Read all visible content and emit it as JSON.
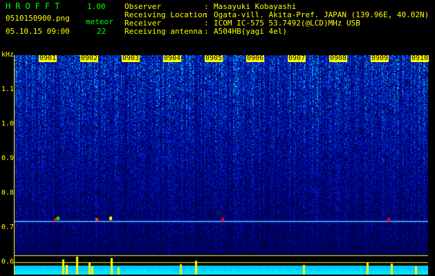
{
  "header": {
    "app_title": "HROFFT",
    "version": "1.00",
    "filename": "0510150900.png",
    "meteor_label": "meteor",
    "datetime": "05.10.15 09:00",
    "meteor_count": "22",
    "fields": [
      {
        "key": "Observer",
        "value": "Masayuki Kobayashi"
      },
      {
        "key": "Receiving Location",
        "value": "Ogata-vill. Akita-Pref. JAPAN (139.96E, 40.02N)"
      },
      {
        "key": "Receiver",
        "value": "ICOM IC-575 53.7492(@LCD)MHz USB"
      },
      {
        "key": "Receiving antenna",
        "value": "A504HB(yagi 4el)"
      }
    ]
  },
  "spectrogram": {
    "y_unit": "kHz",
    "y_ticks": [
      "1.1",
      "1.0",
      "0.9",
      "0.8",
      "0.7",
      "0.6"
    ],
    "x_ticks": [
      "0901",
      "0902",
      "0903",
      "0904",
      "0905",
      "0906",
      "0907",
      "0908",
      "0909",
      "0910"
    ]
  },
  "colors": {
    "background": "#000000",
    "label": "#ffff00",
    "title": "#00ff00",
    "noise_base": "#000080",
    "noise_bright": "#00ffff",
    "meteor_echo": "#ff0000"
  }
}
